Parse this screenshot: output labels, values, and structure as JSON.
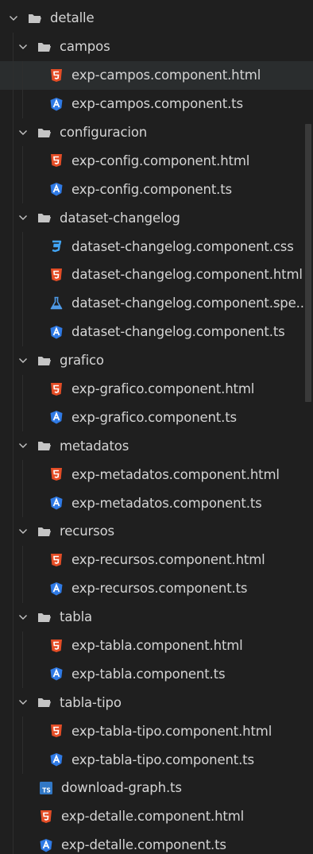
{
  "tree": [
    {
      "type": "folder",
      "depth": 0,
      "label": "detalle"
    },
    {
      "type": "folder",
      "depth": 1,
      "label": "campos"
    },
    {
      "type": "file",
      "depth": 2,
      "icon": "html",
      "label": "exp-campos.component.html",
      "selected": true
    },
    {
      "type": "file",
      "depth": 2,
      "icon": "angular",
      "label": "exp-campos.component.ts"
    },
    {
      "type": "folder",
      "depth": 1,
      "label": "configuracion"
    },
    {
      "type": "file",
      "depth": 2,
      "icon": "html",
      "label": "exp-config.component.html"
    },
    {
      "type": "file",
      "depth": 2,
      "icon": "angular",
      "label": "exp-config.component.ts"
    },
    {
      "type": "folder",
      "depth": 1,
      "label": "dataset-changelog"
    },
    {
      "type": "file",
      "depth": 2,
      "icon": "css",
      "label": "dataset-changelog.component.css"
    },
    {
      "type": "file",
      "depth": 2,
      "icon": "html",
      "label": "dataset-changelog.component.html"
    },
    {
      "type": "file",
      "depth": 2,
      "icon": "spec",
      "label": "dataset-changelog.component.spe..."
    },
    {
      "type": "file",
      "depth": 2,
      "icon": "angular",
      "label": "dataset-changelog.component.ts"
    },
    {
      "type": "folder",
      "depth": 1,
      "label": "grafico"
    },
    {
      "type": "file",
      "depth": 2,
      "icon": "html",
      "label": "exp-grafico.component.html"
    },
    {
      "type": "file",
      "depth": 2,
      "icon": "angular",
      "label": "exp-grafico.component.ts"
    },
    {
      "type": "folder",
      "depth": 1,
      "label": "metadatos"
    },
    {
      "type": "file",
      "depth": 2,
      "icon": "html",
      "label": "exp-metadatos.component.html"
    },
    {
      "type": "file",
      "depth": 2,
      "icon": "angular",
      "label": "exp-metadatos.component.ts"
    },
    {
      "type": "folder",
      "depth": 1,
      "label": "recursos"
    },
    {
      "type": "file",
      "depth": 2,
      "icon": "html",
      "label": "exp-recursos.component.html"
    },
    {
      "type": "file",
      "depth": 2,
      "icon": "angular",
      "label": "exp-recursos.component.ts"
    },
    {
      "type": "folder",
      "depth": 1,
      "label": "tabla"
    },
    {
      "type": "file",
      "depth": 2,
      "icon": "html",
      "label": "exp-tabla.component.html"
    },
    {
      "type": "file",
      "depth": 2,
      "icon": "angular",
      "label": "exp-tabla.component.ts"
    },
    {
      "type": "folder",
      "depth": 1,
      "label": "tabla-tipo"
    },
    {
      "type": "file",
      "depth": 2,
      "icon": "html",
      "label": "exp-tabla-tipo.component.html"
    },
    {
      "type": "file",
      "depth": 2,
      "icon": "angular",
      "label": "exp-tabla-tipo.component.ts"
    },
    {
      "type": "file",
      "depth": 1,
      "icon": "ts",
      "label": "download-graph.ts"
    },
    {
      "type": "file",
      "depth": 1,
      "icon": "html",
      "label": "exp-detalle.component.html"
    },
    {
      "type": "file",
      "depth": 1,
      "icon": "angular",
      "label": "exp-detalle.component.ts"
    }
  ],
  "icons": {
    "html": {
      "name": "html5-icon",
      "color": "#e44d26",
      "text": "5"
    },
    "angular": {
      "name": "angular-icon",
      "color": "#2f7ae5",
      "text": "A"
    },
    "css": {
      "name": "css3-icon",
      "color": "#42a5f5",
      "text": "3"
    },
    "spec": {
      "name": "test-flask-icon",
      "color": "#4f9be8",
      "text": ""
    },
    "ts": {
      "name": "typescript-icon",
      "color": "#3178c6",
      "text": "TS"
    },
    "folder": {
      "name": "folder-open-icon",
      "color": "#c5c5c5"
    },
    "chevron": {
      "name": "chevron-down-icon",
      "color": "#c5c5c5"
    }
  }
}
